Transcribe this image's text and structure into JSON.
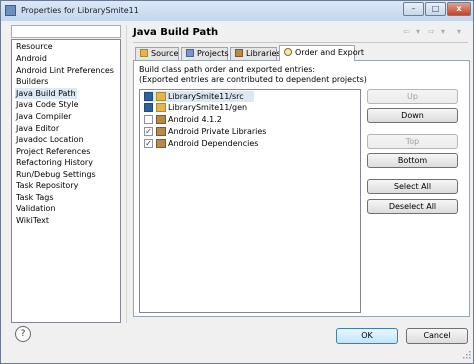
{
  "window": {
    "title": "Properties for LibrarySmite11",
    "ghost_title": "...",
    "minimize_glyph": "–",
    "maximize_glyph": "□",
    "close_glyph": "x"
  },
  "sidebar": {
    "filter_value": "",
    "items": [
      {
        "label": "Resource"
      },
      {
        "label": "Android"
      },
      {
        "label": "Android Lint Preferences"
      },
      {
        "label": "Builders"
      },
      {
        "label": "Java Build Path"
      },
      {
        "label": "Java Code Style"
      },
      {
        "label": "Java Compiler"
      },
      {
        "label": "Java Editor"
      },
      {
        "label": "Javadoc Location"
      },
      {
        "label": "Project References"
      },
      {
        "label": "Refactoring History"
      },
      {
        "label": "Run/Debug Settings"
      },
      {
        "label": "Task Repository"
      },
      {
        "label": "Task Tags"
      },
      {
        "label": "Validation"
      },
      {
        "label": "WikiText"
      }
    ]
  },
  "page": {
    "title": "Java Build Path",
    "back_glyph": "⇦",
    "back_menu_glyph": "▾",
    "forward_glyph": "⇨",
    "forward_menu_glyph": "▾",
    "menu_glyph": "▾"
  },
  "tabs": [
    {
      "label": "Source"
    },
    {
      "label": "Projects"
    },
    {
      "label": "Libraries"
    },
    {
      "label": "Order and Export"
    }
  ],
  "order_export": {
    "description_line1": "Build class path order and exported entries:",
    "description_line2": "(Exported entries are contributed to dependent projects)",
    "entries": [
      {
        "label": "LibrarySmite11/src",
        "checked": true
      },
      {
        "label": "LibrarySmite11/gen",
        "checked": true
      },
      {
        "label": "Android 4.1.2",
        "checked": false
      },
      {
        "label": "Android Private Libraries",
        "checked": true
      },
      {
        "label": "Android Dependencies",
        "checked": true
      }
    ],
    "buttons": {
      "up": "Up",
      "down": "Down",
      "top": "Top",
      "bottom": "Bottom",
      "select_all": "Select All",
      "deselect_all": "Deselect All"
    }
  },
  "footer": {
    "help_glyph": "?",
    "ok_label": "OK",
    "cancel_label": "Cancel"
  },
  "colors": {
    "selection": "#dde8f5",
    "checkbox_fill": "#2f5f9e",
    "folder": "#e2b64a",
    "jar": "#b88a4a"
  }
}
